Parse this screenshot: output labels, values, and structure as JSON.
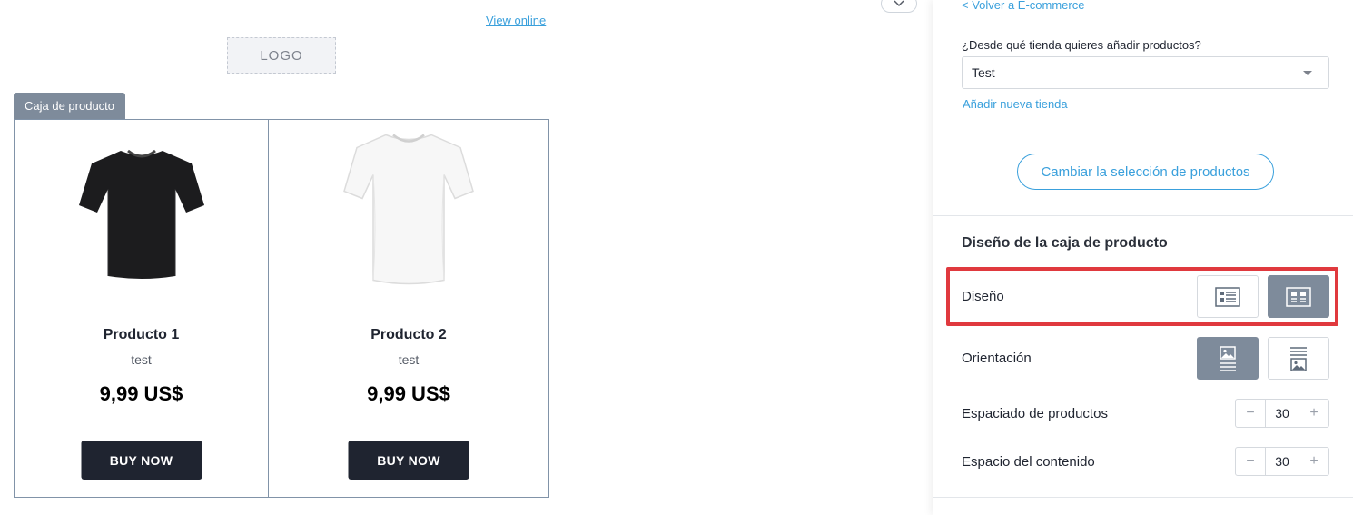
{
  "canvas": {
    "view_online": "View online",
    "logo": "LOGO",
    "block_tag": "Caja de producto",
    "products": [
      {
        "name": "Producto 1",
        "description": "test",
        "price": "9,99 US$",
        "button": "BUY NOW",
        "image": "black-tshirt"
      },
      {
        "name": "Producto 2",
        "description": "test",
        "price": "9,99 US$",
        "button": "BUY NOW",
        "image": "white-tshirt"
      }
    ]
  },
  "panel": {
    "back_link": "< Volver a E-commerce",
    "store_question": "¿Desde qué tienda quieres añadir productos?",
    "store_select": {
      "value": "Test"
    },
    "add_store": "Añadir nueva tienda",
    "change_selection": "Cambiar la selección de productos",
    "design_section": {
      "title": "Diseño de la caja de producto",
      "layout_label": "Diseño",
      "layout_options": [
        {
          "icon": "list-layout-icon",
          "active": false
        },
        {
          "icon": "grid-layout-icon",
          "active": true
        }
      ],
      "orientation_label": "Orientación",
      "orientation_options": [
        {
          "icon": "image-top-icon",
          "active": true
        },
        {
          "icon": "image-bottom-icon",
          "active": false
        }
      ],
      "spacing_products_label": "Espaciado de productos",
      "spacing_products_value": "30",
      "content_spacing_label": "Espacio del contenido",
      "content_spacing_value": "30"
    }
  },
  "colors": {
    "accent": "#3aa0dc",
    "highlight": "#e0393e",
    "active_option": "#7e8b9b",
    "button_dark": "#1f2430"
  }
}
